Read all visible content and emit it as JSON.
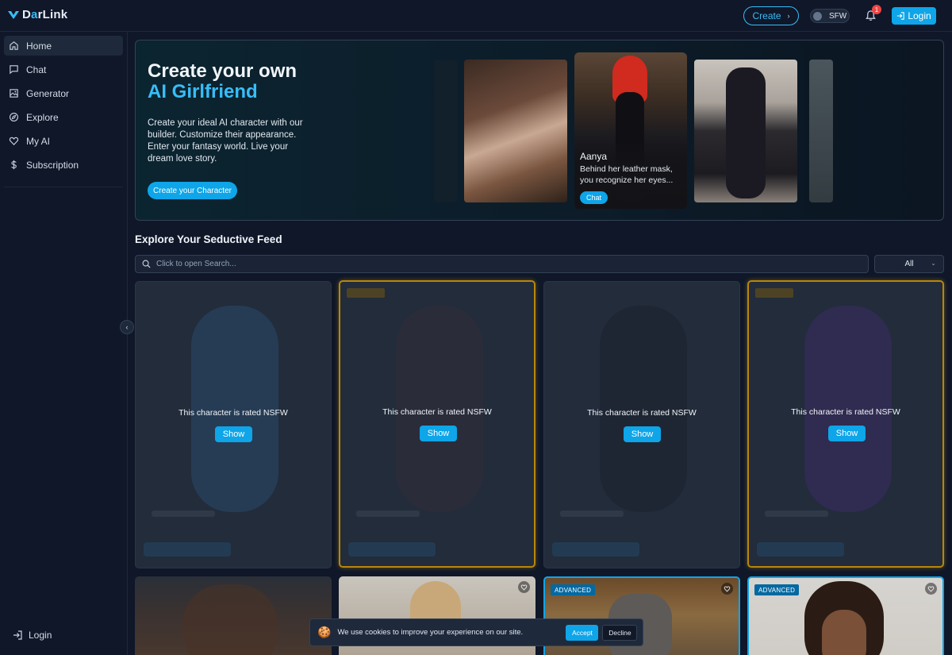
{
  "header": {
    "logo_text_prefix": "D",
    "logo_text_accent": "a",
    "logo_text_rest": "rLink",
    "create_label": "Create",
    "sfw_label": "SFW",
    "notification_count": "1",
    "login_label": "Login"
  },
  "sidebar": {
    "items": [
      {
        "label": "Home",
        "icon": "home-icon"
      },
      {
        "label": "Chat",
        "icon": "chat-icon"
      },
      {
        "label": "Generator",
        "icon": "image-icon"
      },
      {
        "label": "Explore",
        "icon": "compass-icon"
      },
      {
        "label": "My AI",
        "icon": "heart-icon"
      },
      {
        "label": "Subscription",
        "icon": "dollar-icon"
      }
    ],
    "login_label": "Login"
  },
  "hero": {
    "title_line1": "Create your own",
    "title_line2": "AI Girlfriend",
    "description": "Create your ideal AI character with our builder. Customize their appearance. Enter your fantasy world. Live your dream love story.",
    "cta_label": "Create your Character",
    "featured": {
      "name": "Aanya",
      "description": "Behind her leather mask, you recognize her eyes...",
      "chat_label": "Chat"
    }
  },
  "feed": {
    "title": "Explore Your Seductive Feed",
    "search_placeholder": "Click to open Search...",
    "filter_value": "All",
    "nsfw_text": "This character is rated NSFW",
    "show_label": "Show",
    "advanced_badge": "ADVANCED"
  },
  "cookie": {
    "icon": "🍪",
    "text": "We use cookies to improve your experience on our site.",
    "accept_label": "Accept",
    "decline_label": "Decline"
  },
  "colors": {
    "background": "#0f1729",
    "accent": "#0ea5e9",
    "accent_text": "#38bdf8",
    "premium_border": "#b8860b",
    "notification": "#ef4444"
  }
}
